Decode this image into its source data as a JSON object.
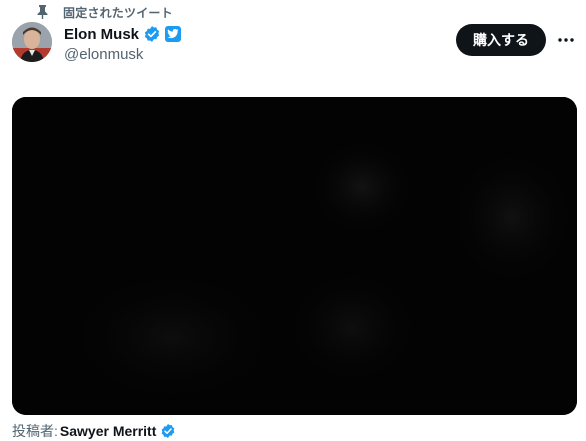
{
  "pinned": {
    "label": "固定されたツイート",
    "icon": "pin-icon"
  },
  "author": {
    "display_name": "Elon Musk",
    "handle": "@elonmusk",
    "verified_icon": "verified-badge-icon",
    "affiliate_icon": "twitter-affiliate-icon"
  },
  "actions": {
    "buy_label": "購入する",
    "more_icon": "more-icon"
  },
  "media": {
    "type": "video"
  },
  "byline": {
    "label": "投稿者:",
    "name": "Sawyer Merritt",
    "verified_icon": "verified-badge-icon"
  },
  "colors": {
    "text_primary": "#0f1419",
    "text_secondary": "#536471",
    "verified_blue": "#1d9bf0",
    "button_bg": "#0f1419",
    "media_bg": "#030303"
  }
}
